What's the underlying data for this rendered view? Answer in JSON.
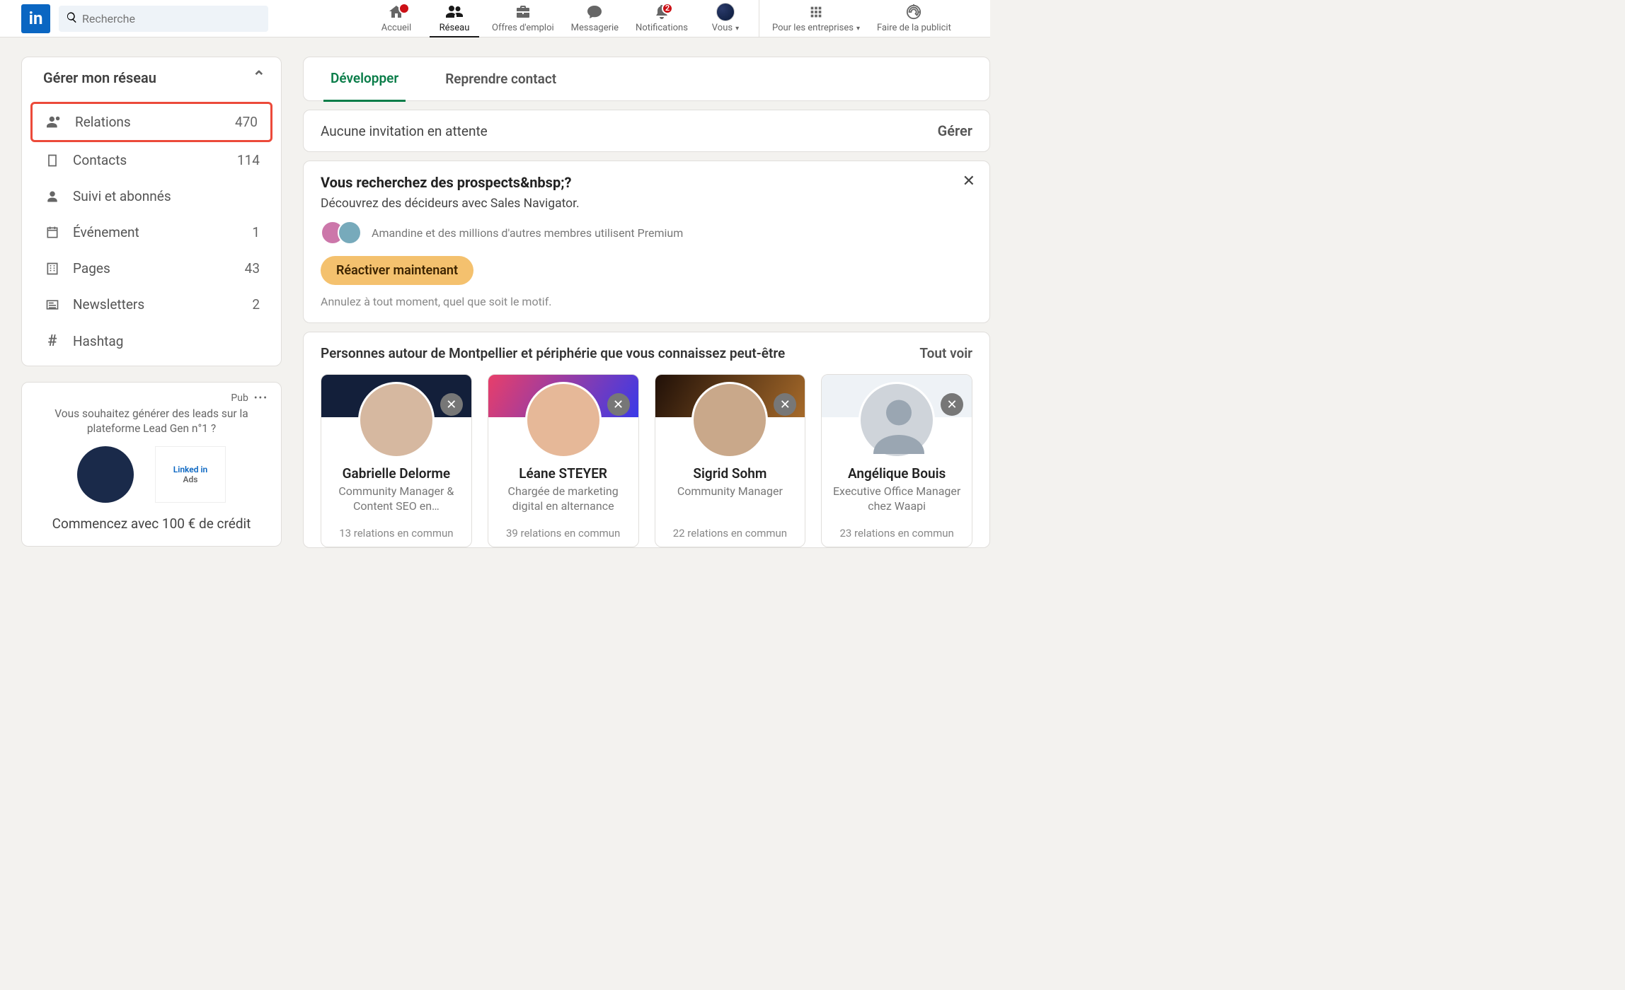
{
  "search": {
    "placeholder": "Recherche"
  },
  "nav": {
    "home": "Accueil",
    "network": "Réseau",
    "jobs": "Offres d'emploi",
    "messaging": "Messagerie",
    "notifications": "Notifications",
    "notif_badge": "2",
    "me": "Vous",
    "business": "Pour les entreprises",
    "advertise": "Faire de la publicit"
  },
  "sidebar": {
    "title": "Gérer mon réseau",
    "items": [
      {
        "label": "Relations",
        "count": "470"
      },
      {
        "label": "Contacts",
        "count": "114"
      },
      {
        "label": "Suivi et abonnés",
        "count": ""
      },
      {
        "label": "Événement",
        "count": "1"
      },
      {
        "label": "Pages",
        "count": "43"
      },
      {
        "label": "Newsletters",
        "count": "2"
      },
      {
        "label": "Hashtag",
        "count": ""
      }
    ]
  },
  "ad": {
    "tag": "Pub",
    "text": "Vous souhaitez générer des leads sur la plateforme Lead Gen n°1 ?",
    "logo_line1": "Linked in",
    "logo_line2": "Ads",
    "cta": "Commencez avec 100 € de crédit"
  },
  "tabs": {
    "grow": "Développer",
    "reconnect": "Reprendre contact"
  },
  "invites": {
    "label": "Aucune invitation en attente",
    "manage": "Gérer"
  },
  "promo": {
    "title": "Vous recherchez des prospects&nbsp;?",
    "sub": "Découvrez des décideurs avec Sales Navigator.",
    "who": "Amandine et des millions d'autres membres utilisent Premium",
    "button": "Réactiver maintenant",
    "note": "Annulez à tout moment, quel que soit le motif."
  },
  "sugg": {
    "title": "Personnes autour de Montpellier et périphérie que vous connaissez peut-être",
    "see_all": "Tout voir",
    "people": [
      {
        "name": "Gabrielle Delorme",
        "role": "Community Manager & Content SEO en…",
        "mutual": "13 relations en commun"
      },
      {
        "name": "Léane STEYER",
        "role": "Chargée de marketing digital en alternance",
        "mutual": "39 relations en commun"
      },
      {
        "name": "Sigrid Sohm",
        "role": "Community Manager",
        "mutual": "22 relations en commun"
      },
      {
        "name": "Angélique Bouis",
        "role": "Executive Office Manager chez Waapi",
        "mutual": "23 relations en commun"
      }
    ]
  }
}
